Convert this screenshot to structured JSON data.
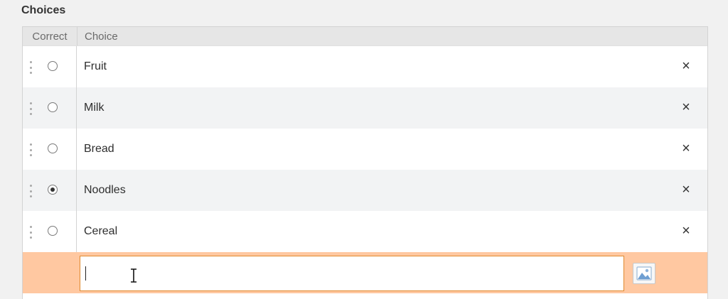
{
  "section": {
    "title": "Choices"
  },
  "table": {
    "headers": {
      "correct": "Correct",
      "choice": "Choice"
    },
    "rows": [
      {
        "label": "Fruit",
        "correct": false,
        "remove": "×"
      },
      {
        "label": "Milk",
        "correct": false,
        "remove": "×"
      },
      {
        "label": "Bread",
        "correct": false,
        "remove": "×"
      },
      {
        "label": "Noodles",
        "correct": true,
        "remove": "×"
      },
      {
        "label": "Cereal",
        "correct": false,
        "remove": "×"
      }
    ]
  },
  "new_choice": {
    "value": "",
    "placeholder": ""
  },
  "icons": {
    "drag": "drag-handle-icon",
    "remove": "close-icon",
    "image": "image-icon",
    "cursor": "text-cursor-icon"
  },
  "colors": {
    "new_row_bg": "#ffc8a1",
    "input_border": "#e0892d",
    "header_bg": "#e6e6e6"
  }
}
